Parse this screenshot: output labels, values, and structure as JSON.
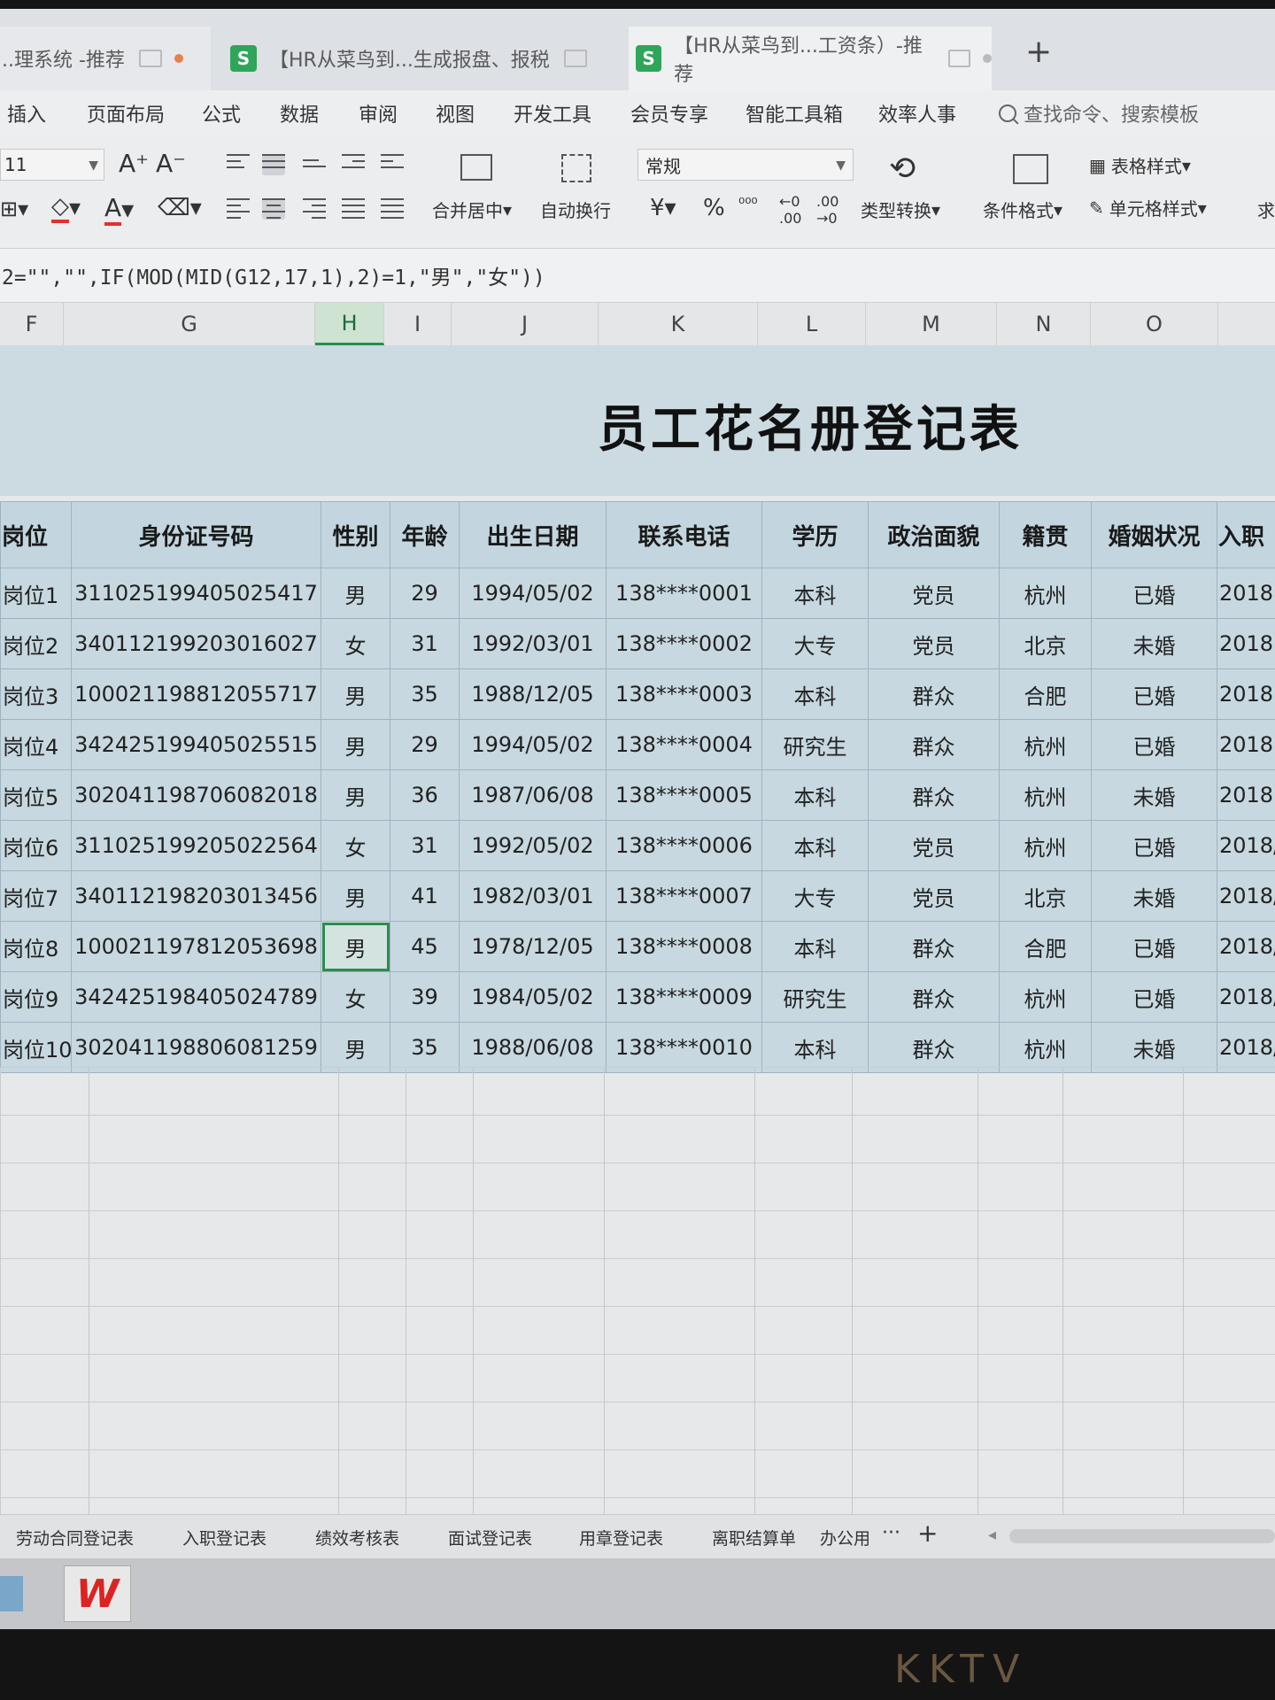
{
  "tabs": [
    {
      "label": "..理系统 -推荐",
      "badge": ""
    },
    {
      "label": "【HR从菜鸟到...生成报盘、报税",
      "badge": "S"
    },
    {
      "label": "【HR从菜鸟到...工资条）-推荐",
      "badge": "S"
    }
  ],
  "new_tab": "+",
  "menu": [
    "插入",
    "页面布局",
    "公式",
    "数据",
    "审阅",
    "视图",
    "开发工具",
    "会员专享",
    "智能工具箱",
    "效率人事"
  ],
  "search_placeholder": "查找命令、搜索模板",
  "ribbon": {
    "font_size": "11",
    "merge_center": "合并居中",
    "wrap_text": "自动换行",
    "number_format": "常规",
    "currency": "¥",
    "percent": "%",
    "type_convert": "类型转换",
    "conditional_format": "条件格式",
    "table_style": "表格样式",
    "cell_style": "单元格样式",
    "cut_label": "求"
  },
  "formula": "2=\"\",\"\",IF(MOD(MID(G12,17,1),2)=1,\"男\",\"女\"))",
  "columns": [
    "F",
    "G",
    "H",
    "I",
    "J",
    "K",
    "L",
    "M",
    "N",
    "O"
  ],
  "selected_column": "H",
  "sheet_title": "员工花名册登记表",
  "table": {
    "headers": [
      "岗位",
      "身份证号码",
      "性别",
      "年龄",
      "出生日期",
      "联系电话",
      "学历",
      "政治面貌",
      "籍贯",
      "婚姻状况",
      "入职"
    ],
    "rows": [
      [
        "岗位1",
        "311025199405025417",
        "男",
        "29",
        "1994/05/02",
        "138****0001",
        "本科",
        "党员",
        "杭州",
        "已婚",
        "2018"
      ],
      [
        "岗位2",
        "340112199203016027",
        "女",
        "31",
        "1992/03/01",
        "138****0002",
        "大专",
        "党员",
        "北京",
        "未婚",
        "2018"
      ],
      [
        "岗位3",
        "100021198812055717",
        "男",
        "35",
        "1988/12/05",
        "138****0003",
        "本科",
        "群众",
        "合肥",
        "已婚",
        "2018"
      ],
      [
        "岗位4",
        "342425199405025515",
        "男",
        "29",
        "1994/05/02",
        "138****0004",
        "研究生",
        "群众",
        "杭州",
        "已婚",
        "2018."
      ],
      [
        "岗位5",
        "302041198706082018",
        "男",
        "36",
        "1987/06/08",
        "138****0005",
        "本科",
        "群众",
        "杭州",
        "未婚",
        "2018."
      ],
      [
        "岗位6",
        "311025199205022564",
        "女",
        "31",
        "1992/05/02",
        "138****0006",
        "本科",
        "党员",
        "杭州",
        "已婚",
        "2018/"
      ],
      [
        "岗位7",
        "340112198203013456",
        "男",
        "41",
        "1982/03/01",
        "138****0007",
        "大专",
        "党员",
        "北京",
        "未婚",
        "2018/"
      ],
      [
        "岗位8",
        "100021197812053698",
        "男",
        "45",
        "1978/12/05",
        "138****0008",
        "本科",
        "群众",
        "合肥",
        "已婚",
        "2018/"
      ],
      [
        "岗位9",
        "342425198405024789",
        "女",
        "39",
        "1984/05/02",
        "138****0009",
        "研究生",
        "群众",
        "杭州",
        "已婚",
        "2018/"
      ],
      [
        "岗位10",
        "302041198806081259",
        "男",
        "35",
        "1988/06/08",
        "138****0010",
        "本科",
        "群众",
        "杭州",
        "未婚",
        "2018/"
      ]
    ]
  },
  "sheet_tabs": [
    "劳动合同登记表",
    "入职登记表",
    "绩效考核表",
    "面试登记表",
    "用章登记表",
    "离职结算单",
    "办公用"
  ],
  "sheet_more": "···",
  "sheet_add": "+",
  "brand": "KKTV",
  "colors": {
    "accent_green": "#2e8b4f",
    "table_fill": "#c7d8e0",
    "wps_red": "#d22222"
  }
}
